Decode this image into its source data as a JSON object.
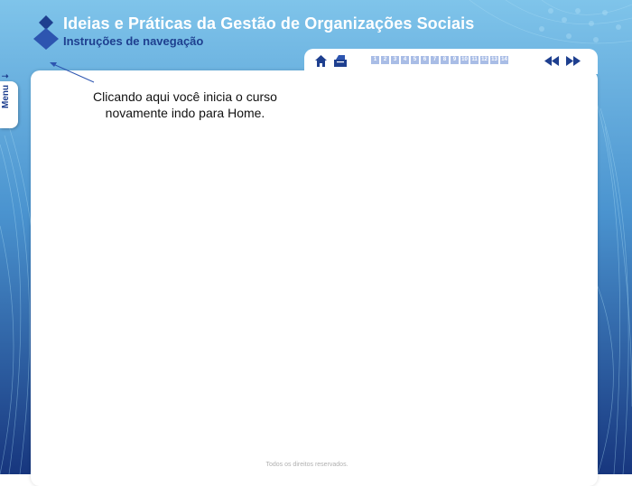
{
  "header": {
    "title": "Ideias e Práticas da Gestão de Organizações Sociais",
    "subtitle": "Instruções de navegação"
  },
  "side_menu": {
    "label": "Menu",
    "icon": "arrow-down-icon"
  },
  "toolbar": {
    "home_icon": "home-icon",
    "index_icon": "index-icon",
    "pages": [
      "1",
      "2",
      "3",
      "4",
      "5",
      "6",
      "7",
      "8",
      "9",
      "10",
      "11",
      "12",
      "13",
      "14"
    ],
    "prev_icon": "double-left-arrow-icon",
    "next_icon": "double-right-arrow-icon"
  },
  "content": {
    "instruction": "Clicando aqui você inicia o curso novamente indo para Home."
  },
  "footer": {
    "text": "Todos os direitos reservados."
  },
  "colors": {
    "brand_blue": "#1e3f8f",
    "page_button": "#a9bde6",
    "sky": "#7fc4ea"
  }
}
